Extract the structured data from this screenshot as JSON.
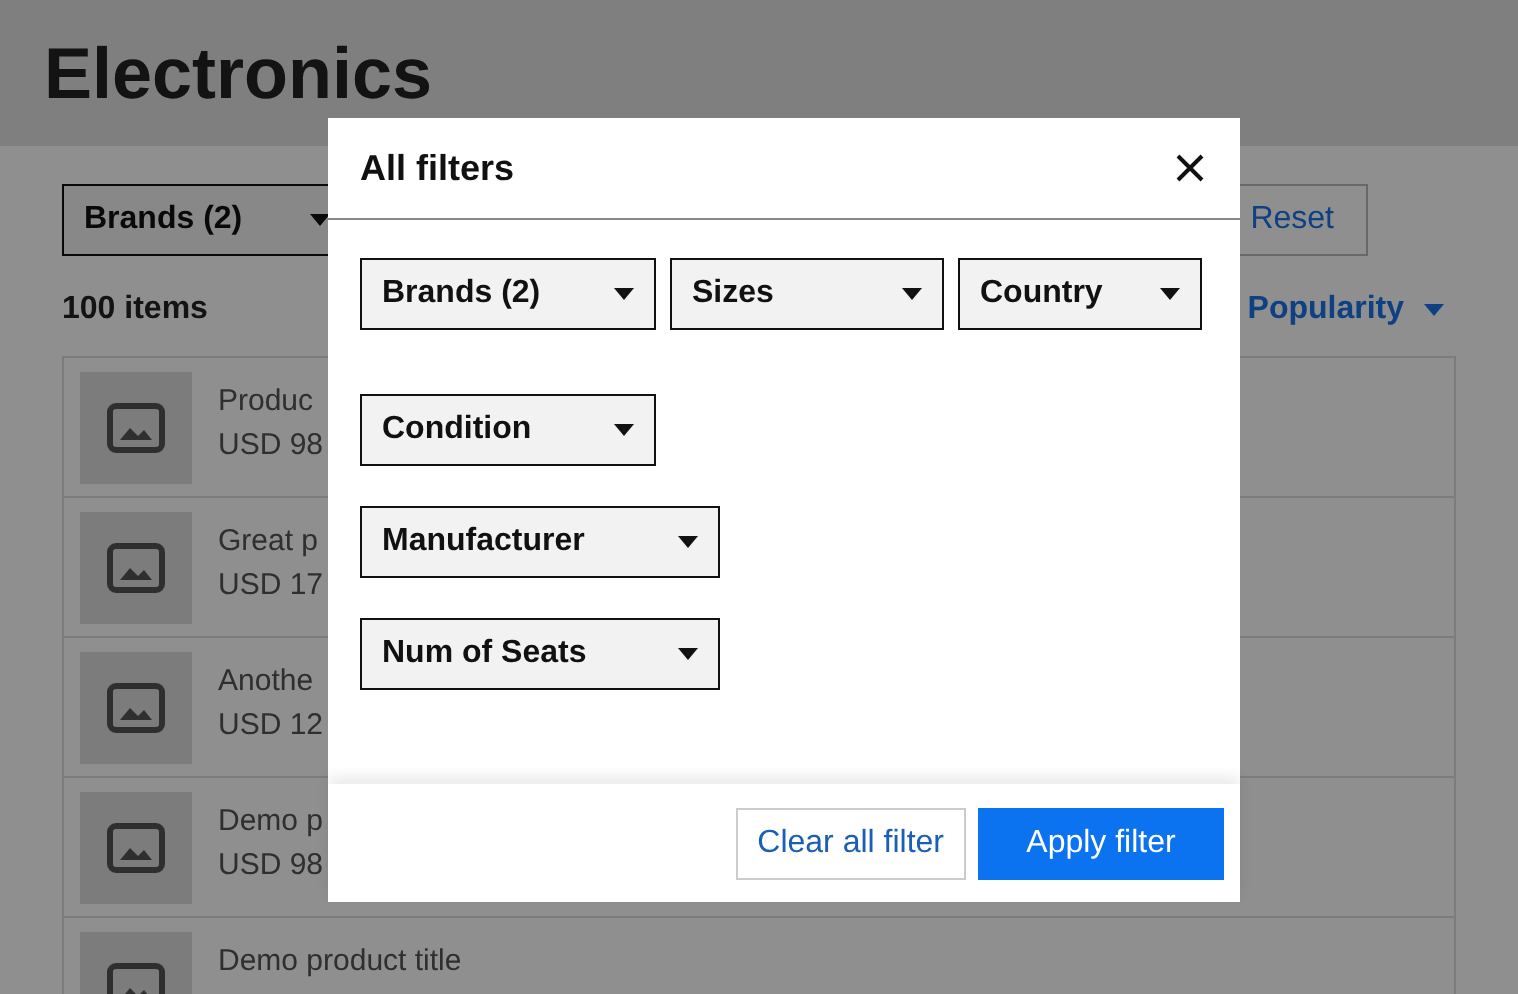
{
  "page": {
    "title": "Electronics",
    "filter_dropdown": "Brands (2)",
    "reset_button": "Reset",
    "item_count": "100 items",
    "sort": "Popularity",
    "products": [
      {
        "name": "Produc",
        "price": "USD 98"
      },
      {
        "name": "Great p",
        "price": "USD 17"
      },
      {
        "name": "Anothe",
        "price": "USD 12"
      },
      {
        "name": "Demo p",
        "price": "USD 98"
      },
      {
        "name": "Demo product title"
      }
    ]
  },
  "modal": {
    "title": "All filters",
    "filter_rows": [
      {
        "filters": [
          "Brands (2)",
          "Sizes",
          "Country"
        ]
      },
      {
        "filters": [
          "Condition"
        ]
      },
      {
        "filters": [
          "Manufacturer"
        ]
      },
      {
        "filters": [
          "Num of Seats"
        ]
      }
    ],
    "clear_button": "Clear all filter",
    "apply_button": "Apply filter"
  }
}
